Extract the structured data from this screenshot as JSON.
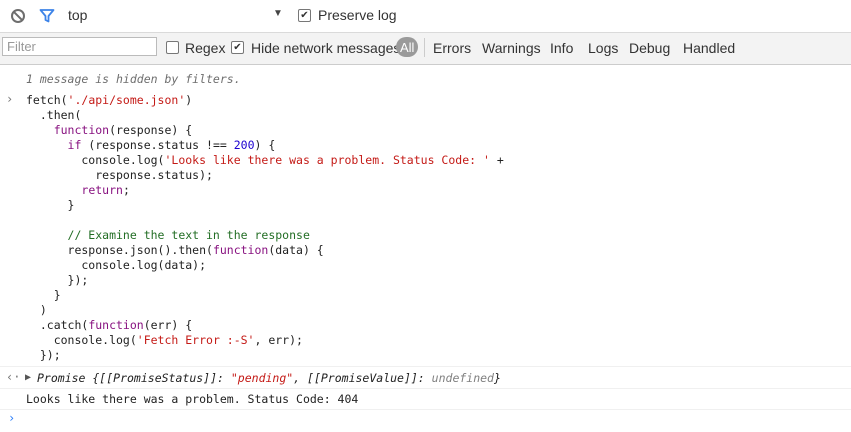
{
  "toolbar_top": {
    "clear_icon": "block-icon",
    "filter_icon": "funnel-icon",
    "context": "top",
    "preserve_log_label": "Preserve log",
    "preserve_log_checked": true
  },
  "toolbar_filter": {
    "filter_placeholder": "Filter",
    "regex_label": "Regex",
    "regex_checked": false,
    "hide_network_label": "Hide network messages",
    "hide_network_checked": true,
    "all_label": "All",
    "levels": [
      "Errors",
      "Warnings",
      "Info",
      "Logs",
      "Debug",
      "Handled"
    ]
  },
  "console": {
    "hidden_message": "1 message is hidden by filters.",
    "code_lines": [
      "fetch('./api/some.json')",
      "  .then(",
      "    function(response) {",
      "      if (response.status !== 200) {",
      "        console.log('Looks like there was a problem. Status Code: ' +",
      "          response.status);",
      "        return;",
      "      }",
      "",
      "      // Examine the text in the response",
      "      response.json().then(function(data) {",
      "        console.log(data);",
      "      });",
      "    }",
      "  )",
      "  .catch(function(err) {",
      "    console.log('Fetch Error :-S', err);",
      "  });"
    ],
    "result": "Promise {[[PromiseStatus]]: \"pending\", [[PromiseValue]]: undefined}",
    "result_parts": {
      "prefix": "Promise {[[PromiseStatus]]: ",
      "status": "\"pending\"",
      "mid": ", [[PromiseValue]]: ",
      "value": "undefined",
      "suffix": "}"
    },
    "log_message": "Looks like there was a problem. Status Code: 404"
  }
}
